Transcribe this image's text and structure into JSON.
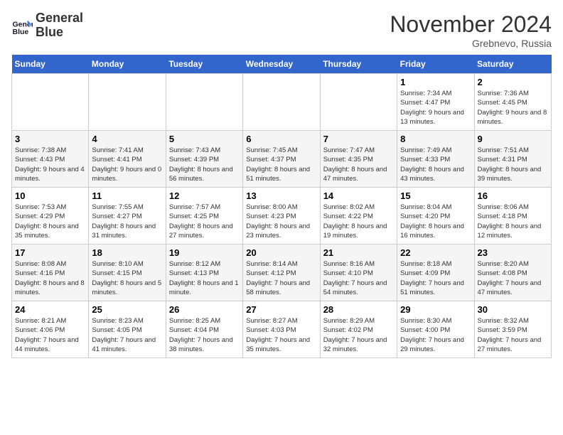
{
  "logo": {
    "line1": "General",
    "line2": "Blue"
  },
  "title": "November 2024",
  "location": "Grebnevo, Russia",
  "days_of_week": [
    "Sunday",
    "Monday",
    "Tuesday",
    "Wednesday",
    "Thursday",
    "Friday",
    "Saturday"
  ],
  "weeks": [
    [
      {
        "day": "",
        "info": ""
      },
      {
        "day": "",
        "info": ""
      },
      {
        "day": "",
        "info": ""
      },
      {
        "day": "",
        "info": ""
      },
      {
        "day": "",
        "info": ""
      },
      {
        "day": "1",
        "info": "Sunrise: 7:34 AM\nSunset: 4:47 PM\nDaylight: 9 hours and 13 minutes."
      },
      {
        "day": "2",
        "info": "Sunrise: 7:36 AM\nSunset: 4:45 PM\nDaylight: 9 hours and 8 minutes."
      }
    ],
    [
      {
        "day": "3",
        "info": "Sunrise: 7:38 AM\nSunset: 4:43 PM\nDaylight: 9 hours and 4 minutes."
      },
      {
        "day": "4",
        "info": "Sunrise: 7:41 AM\nSunset: 4:41 PM\nDaylight: 9 hours and 0 minutes."
      },
      {
        "day": "5",
        "info": "Sunrise: 7:43 AM\nSunset: 4:39 PM\nDaylight: 8 hours and 56 minutes."
      },
      {
        "day": "6",
        "info": "Sunrise: 7:45 AM\nSunset: 4:37 PM\nDaylight: 8 hours and 51 minutes."
      },
      {
        "day": "7",
        "info": "Sunrise: 7:47 AM\nSunset: 4:35 PM\nDaylight: 8 hours and 47 minutes."
      },
      {
        "day": "8",
        "info": "Sunrise: 7:49 AM\nSunset: 4:33 PM\nDaylight: 8 hours and 43 minutes."
      },
      {
        "day": "9",
        "info": "Sunrise: 7:51 AM\nSunset: 4:31 PM\nDaylight: 8 hours and 39 minutes."
      }
    ],
    [
      {
        "day": "10",
        "info": "Sunrise: 7:53 AM\nSunset: 4:29 PM\nDaylight: 8 hours and 35 minutes."
      },
      {
        "day": "11",
        "info": "Sunrise: 7:55 AM\nSunset: 4:27 PM\nDaylight: 8 hours and 31 minutes."
      },
      {
        "day": "12",
        "info": "Sunrise: 7:57 AM\nSunset: 4:25 PM\nDaylight: 8 hours and 27 minutes."
      },
      {
        "day": "13",
        "info": "Sunrise: 8:00 AM\nSunset: 4:23 PM\nDaylight: 8 hours and 23 minutes."
      },
      {
        "day": "14",
        "info": "Sunrise: 8:02 AM\nSunset: 4:22 PM\nDaylight: 8 hours and 19 minutes."
      },
      {
        "day": "15",
        "info": "Sunrise: 8:04 AM\nSunset: 4:20 PM\nDaylight: 8 hours and 16 minutes."
      },
      {
        "day": "16",
        "info": "Sunrise: 8:06 AM\nSunset: 4:18 PM\nDaylight: 8 hours and 12 minutes."
      }
    ],
    [
      {
        "day": "17",
        "info": "Sunrise: 8:08 AM\nSunset: 4:16 PM\nDaylight: 8 hours and 8 minutes."
      },
      {
        "day": "18",
        "info": "Sunrise: 8:10 AM\nSunset: 4:15 PM\nDaylight: 8 hours and 5 minutes."
      },
      {
        "day": "19",
        "info": "Sunrise: 8:12 AM\nSunset: 4:13 PM\nDaylight: 8 hours and 1 minute."
      },
      {
        "day": "20",
        "info": "Sunrise: 8:14 AM\nSunset: 4:12 PM\nDaylight: 7 hours and 58 minutes."
      },
      {
        "day": "21",
        "info": "Sunrise: 8:16 AM\nSunset: 4:10 PM\nDaylight: 7 hours and 54 minutes."
      },
      {
        "day": "22",
        "info": "Sunrise: 8:18 AM\nSunset: 4:09 PM\nDaylight: 7 hours and 51 minutes."
      },
      {
        "day": "23",
        "info": "Sunrise: 8:20 AM\nSunset: 4:08 PM\nDaylight: 7 hours and 47 minutes."
      }
    ],
    [
      {
        "day": "24",
        "info": "Sunrise: 8:21 AM\nSunset: 4:06 PM\nDaylight: 7 hours and 44 minutes."
      },
      {
        "day": "25",
        "info": "Sunrise: 8:23 AM\nSunset: 4:05 PM\nDaylight: 7 hours and 41 minutes."
      },
      {
        "day": "26",
        "info": "Sunrise: 8:25 AM\nSunset: 4:04 PM\nDaylight: 7 hours and 38 minutes."
      },
      {
        "day": "27",
        "info": "Sunrise: 8:27 AM\nSunset: 4:03 PM\nDaylight: 7 hours and 35 minutes."
      },
      {
        "day": "28",
        "info": "Sunrise: 8:29 AM\nSunset: 4:02 PM\nDaylight: 7 hours and 32 minutes."
      },
      {
        "day": "29",
        "info": "Sunrise: 8:30 AM\nSunset: 4:00 PM\nDaylight: 7 hours and 29 minutes."
      },
      {
        "day": "30",
        "info": "Sunrise: 8:32 AM\nSunset: 3:59 PM\nDaylight: 7 hours and 27 minutes."
      }
    ]
  ]
}
